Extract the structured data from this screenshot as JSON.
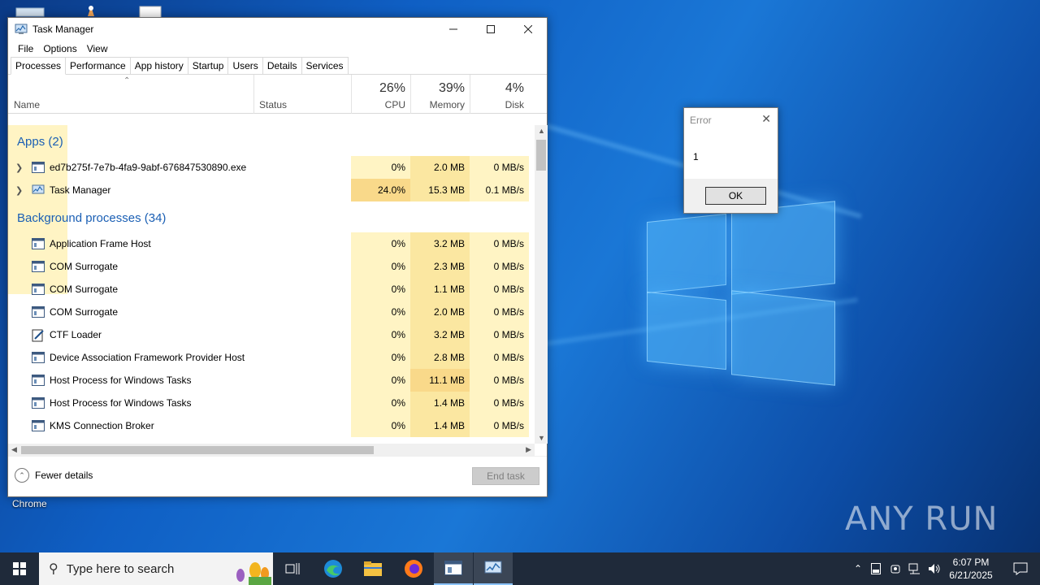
{
  "desktop": {
    "icon_label": "Chrome",
    "watermark": "ANY RUN"
  },
  "task_manager": {
    "title": "Task Manager",
    "menu": [
      "File",
      "Options",
      "View"
    ],
    "tabs": [
      "Processes",
      "Performance",
      "App history",
      "Startup",
      "Users",
      "Details",
      "Services"
    ],
    "active_tab": "Processes",
    "columns": {
      "name": "Name",
      "status": "Status",
      "cpu": {
        "label": "CPU",
        "pct": "26%"
      },
      "memory": {
        "label": "Memory",
        "pct": "39%"
      },
      "disk": {
        "label": "Disk",
        "pct": "4%"
      }
    },
    "groups": {
      "apps": "Apps (2)",
      "background": "Background processes (34)"
    },
    "apps": [
      {
        "name": "ed7b275f-7e7b-4fa9-9abf-676847530890.exe",
        "cpu": "0%",
        "memory": "2.0 MB",
        "disk": "0 MB/s"
      },
      {
        "name": "Task Manager",
        "cpu": "24.0%",
        "memory": "15.3 MB",
        "disk": "0.1 MB/s"
      }
    ],
    "background": [
      {
        "name": "Application Frame Host",
        "cpu": "0%",
        "memory": "3.2 MB",
        "disk": "0 MB/s"
      },
      {
        "name": "COM Surrogate",
        "cpu": "0%",
        "memory": "2.3 MB",
        "disk": "0 MB/s"
      },
      {
        "name": "COM Surrogate",
        "cpu": "0%",
        "memory": "1.1 MB",
        "disk": "0 MB/s"
      },
      {
        "name": "COM Surrogate",
        "cpu": "0%",
        "memory": "2.0 MB",
        "disk": "0 MB/s"
      },
      {
        "name": "CTF Loader",
        "cpu": "0%",
        "memory": "3.2 MB",
        "disk": "0 MB/s"
      },
      {
        "name": "Device Association Framework Provider Host",
        "cpu": "0%",
        "memory": "2.8 MB",
        "disk": "0 MB/s"
      },
      {
        "name": "Host Process for Windows Tasks",
        "cpu": "0%",
        "memory": "11.1 MB",
        "disk": "0 MB/s"
      },
      {
        "name": "Host Process for Windows Tasks",
        "cpu": "0%",
        "memory": "1.4 MB",
        "disk": "0 MB/s"
      },
      {
        "name": "KMS Connection Broker",
        "cpu": "0%",
        "memory": "1.4 MB",
        "disk": "0 MB/s"
      }
    ],
    "fewer_details": "Fewer details",
    "end_task": "End task"
  },
  "error_dialog": {
    "title": "Error",
    "message": "1",
    "ok": "OK"
  },
  "taskbar": {
    "search_placeholder": "Type here to search",
    "time": "6:07 PM",
    "date": "6/21/2025"
  },
  "colors": {
    "cpu_hot": "#f9d98a",
    "cell_light": "#fff4c4",
    "cell_mid": "#fbe7a1",
    "group_blue": "#1a5fb4",
    "taskbar": "#1f2a3a"
  }
}
